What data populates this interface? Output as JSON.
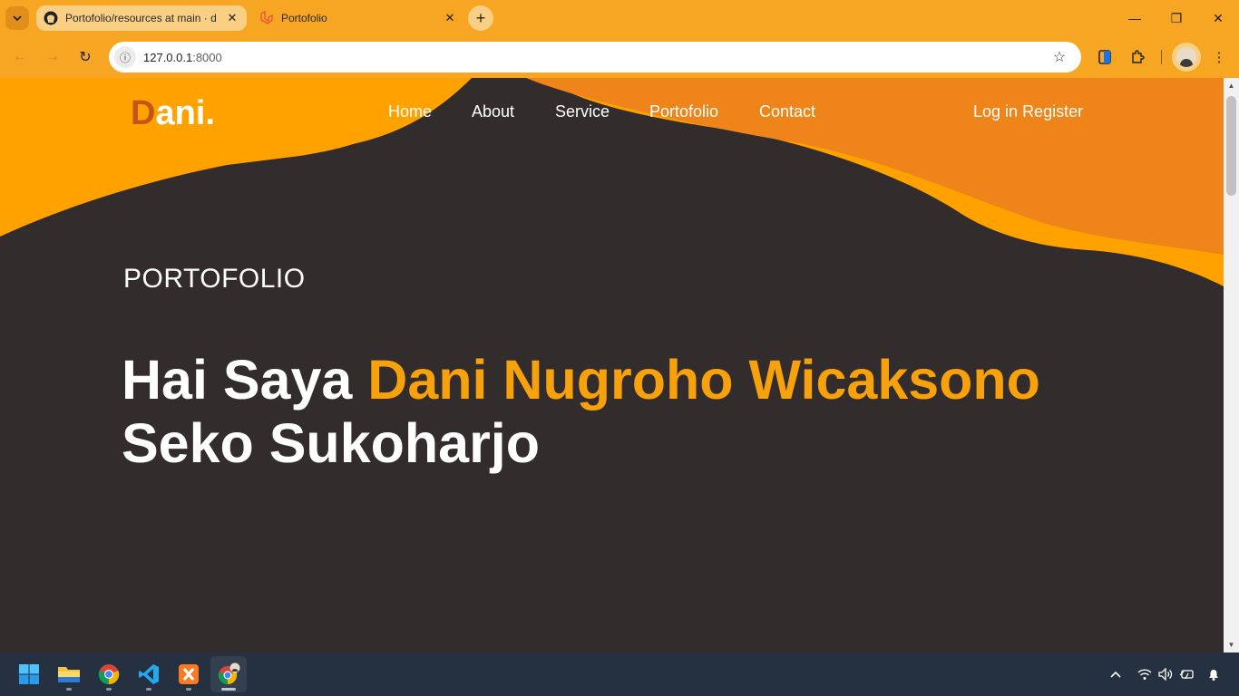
{
  "browser": {
    "tabs": [
      {
        "title": "Portofolio/resources at main · d",
        "favicon": "github-icon",
        "active": false
      },
      {
        "title": "Portofolio",
        "favicon": "laravel-icon",
        "active": true
      }
    ],
    "url_host": "127.0.0.1",
    "url_port": ":8000"
  },
  "site": {
    "logo_first": "D",
    "logo_rest": "ani.",
    "nav": [
      "Home",
      "About",
      "Service",
      "Portofolio",
      "Contact"
    ],
    "login_label": "Log in",
    "register_label": "Register",
    "eyebrow": "PORTOFOLIO",
    "headline_prefix": "Hai Saya ",
    "headline_accent": "Dani Nugroho Wicaksono",
    "headline_suffix": "Seko Sukoharjo"
  },
  "colors": {
    "chrome": "#f6a623",
    "wave_light": "#ffa200",
    "wave_dark": "#ee841a",
    "page_bg": "#332c2c",
    "accent": "#f7a20c"
  },
  "taskbar": {
    "apps": [
      "windows-start-icon",
      "file-explorer-icon",
      "chrome-icon",
      "vscode-icon",
      "xampp-icon",
      "chrome-profile-icon"
    ]
  }
}
